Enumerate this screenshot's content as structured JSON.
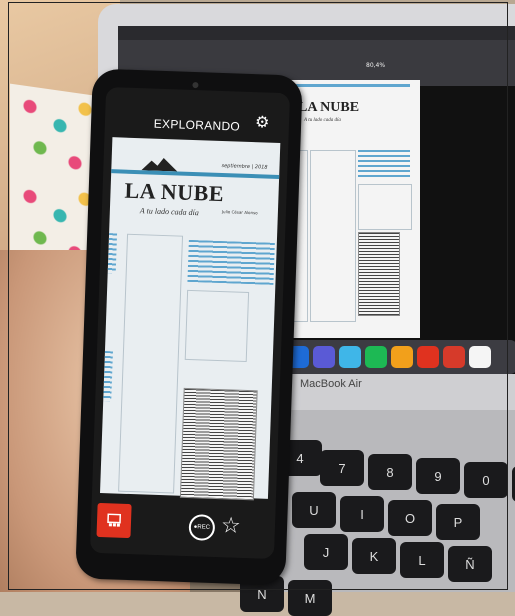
{
  "phone_app": {
    "title": "EXPLORANDO",
    "settings_icon": "gear-icon",
    "rec_label": "●REC",
    "favorite_icon": "star-icon",
    "record_icon": "camera-square-icon",
    "accent_color": "#e0321f"
  },
  "newspaper": {
    "date": "septiembre | 2018",
    "title": "LA NUBE",
    "subtitle": "A tu lado cada día",
    "author": "Julio César Alonso"
  },
  "laptop": {
    "label": "MacBook Air",
    "doc_title": "LA NUBE",
    "doc_subtitle": "A tu lado cada día",
    "toolbar_zoom": "80,4%"
  },
  "keyboard_keys": [
    "4",
    "7",
    "8",
    "9",
    "0",
    "?",
    "U",
    "I",
    "O",
    "P",
    "J",
    "K",
    "L",
    "Ñ",
    "N",
    "M"
  ]
}
